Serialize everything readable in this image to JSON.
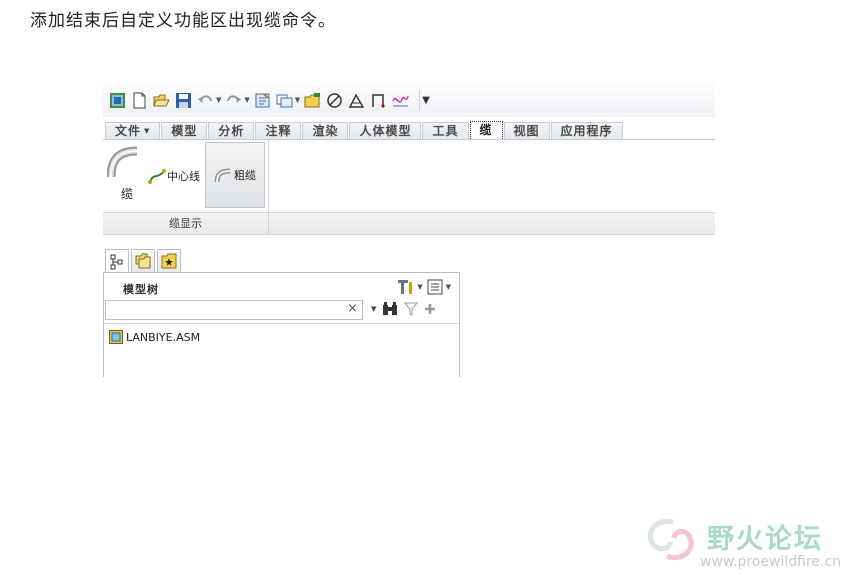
{
  "intro_text": "添加结束后自定义功能区出现缆命令。",
  "tabs": [
    {
      "label": "文件",
      "has_dropdown": true
    },
    {
      "label": "模型"
    },
    {
      "label": "分析"
    },
    {
      "label": "注释"
    },
    {
      "label": "渲染"
    },
    {
      "label": "人体模型"
    },
    {
      "label": "工具"
    },
    {
      "label": "缆",
      "active": true
    },
    {
      "label": "视图"
    },
    {
      "label": "应用程序"
    }
  ],
  "ribbon": {
    "cable_button": "缆",
    "centerline_button": "中心线",
    "rough_cable_button": "粗缆",
    "group_label": "缆显示"
  },
  "model_tree": {
    "title": "模型树",
    "search_value": "",
    "clear_symbol": "×",
    "items": [
      "LANBIYE.ASM"
    ]
  },
  "watermark": {
    "title": "野火论坛",
    "url": "www.proewildfire.cn"
  },
  "colors": {
    "accent_green": "#a7dbc5",
    "tab_border": "#c8cdd3",
    "watermark_gray": "#c6cad0"
  },
  "icons": [
    "window-icon",
    "new-file-icon",
    "open-folder-icon",
    "save-icon",
    "undo-icon",
    "redo-icon",
    "regenerate-icon",
    "windows-icon",
    "folder-icon",
    "circle-slash-icon",
    "triangle-icon",
    "bracket-icon",
    "curve-icon",
    "more-icon"
  ]
}
